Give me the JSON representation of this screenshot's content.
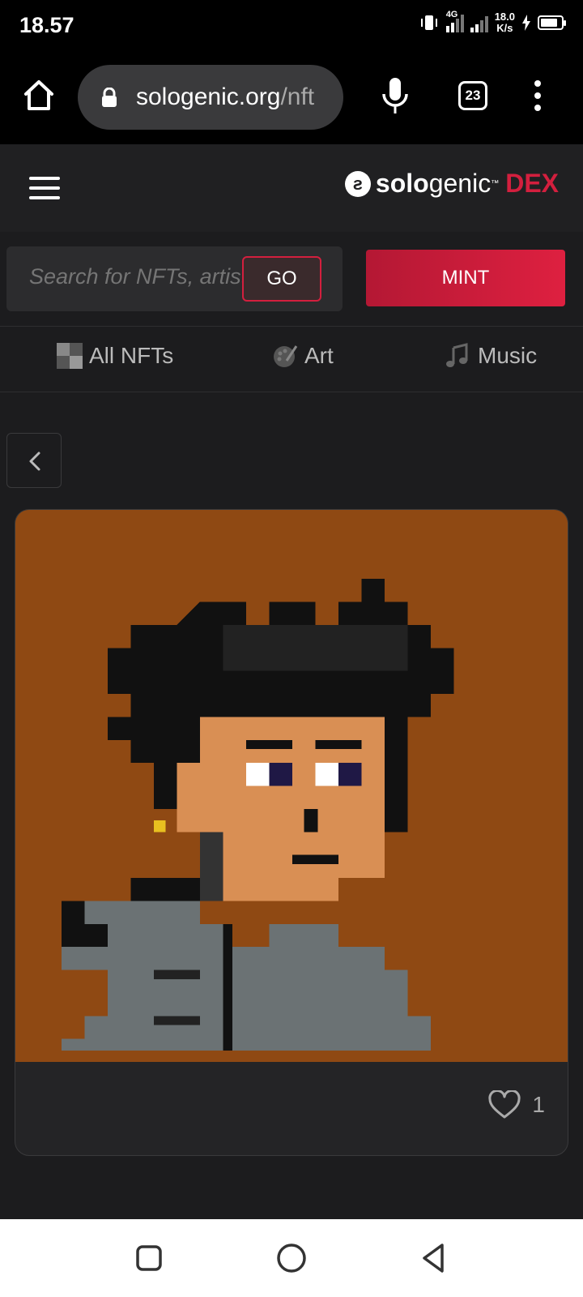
{
  "status_bar": {
    "time": "18.57",
    "network": "4G",
    "speed_value": "18.0",
    "speed_unit": "K/s"
  },
  "browser": {
    "url_domain": "sologenic.org",
    "url_path": "/nft",
    "tab_count": "23"
  },
  "site": {
    "brand_logo_glyph": "ƨ",
    "brand_bold": "solo",
    "brand_rest": "genic",
    "brand_tm": "™",
    "brand_suffix": "DEX",
    "accent_color": "#d31f3e"
  },
  "search": {
    "placeholder": "Search for NFTs, artists",
    "go_label": "GO"
  },
  "mint_label": "MINT",
  "categories": [
    {
      "label": "All NFTs",
      "icon": "grid-icon"
    },
    {
      "label": "Art",
      "icon": "palette-icon"
    },
    {
      "label": "Music",
      "icon": "music-note-icon"
    }
  ],
  "nft": {
    "image_description_icon": "pixel-punk-avatar",
    "background_color": "#8f4913",
    "like_count": "1"
  }
}
